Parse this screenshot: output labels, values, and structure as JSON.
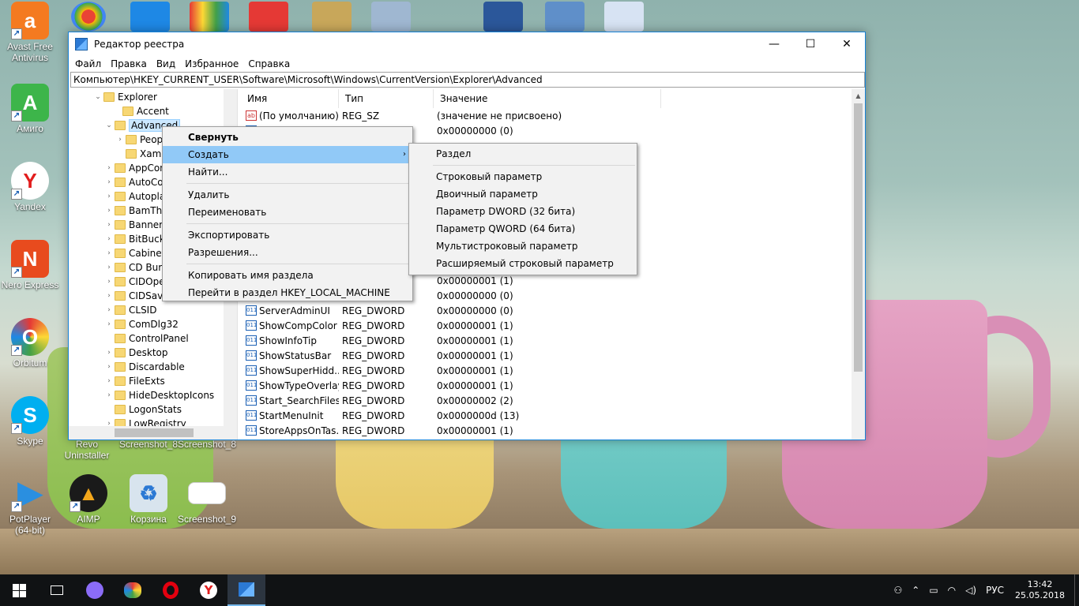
{
  "desktop": {
    "icons": [
      {
        "label": "Avast Free Antivirus",
        "color": "#f47a20",
        "glyph": "a"
      },
      {
        "label": "Амиго",
        "color": "#3db54a",
        "glyph": "A"
      },
      {
        "label": "Yandex",
        "color": "#ffffff",
        "glyph": "Y"
      },
      {
        "label": "Nero Express",
        "color": "#e84b1e",
        "glyph": "N"
      },
      {
        "label": "Orbitum",
        "color": "#e9a52c",
        "glyph": "O"
      },
      {
        "label": "Skype",
        "color": "#00aff0",
        "glyph": "S"
      },
      {
        "label": "PotPlayer (64-bit)",
        "color": "#2a8fe0",
        "glyph": "▶"
      },
      {
        "label": "AIMP",
        "color": "#f3a71b",
        "glyph": "▲"
      },
      {
        "label": "Корзина",
        "color": "#d8e4ee",
        "glyph": "♻"
      },
      {
        "label": "Screenshot_9",
        "color": "#ffffff",
        "glyph": ""
      },
      {
        "label": "Revo Uninstaller",
        "color": "",
        "glyph": ""
      },
      {
        "label": "Screenshot_8",
        "color": "",
        "glyph": ""
      },
      {
        "label": "Screenshot_8",
        "color": "",
        "glyph": ""
      }
    ]
  },
  "window": {
    "title": "Редактор реестра",
    "controls": {
      "minimize": "—",
      "maximize": "☐",
      "close": "✕"
    },
    "menu": [
      "Файл",
      "Правка",
      "Вид",
      "Избранное",
      "Справка"
    ],
    "address": "Компьютер\\HKEY_CURRENT_USER\\Software\\Microsoft\\Windows\\CurrentVersion\\Explorer\\Advanced"
  },
  "tree": {
    "items": [
      {
        "label": "Explorer",
        "expander": "⌄"
      },
      {
        "label": "Accent",
        "expander": ""
      },
      {
        "label": "Advanced",
        "expander": "⌄"
      },
      {
        "label": "Peop",
        "expander": "›"
      },
      {
        "label": "Xaml",
        "expander": ""
      },
      {
        "label": "AppCon",
        "expander": "›"
      },
      {
        "label": "AutoCor",
        "expander": "›"
      },
      {
        "label": "Autoplay",
        "expander": "›"
      },
      {
        "label": "BamThr",
        "expander": "›"
      },
      {
        "label": "BannerS",
        "expander": "›"
      },
      {
        "label": "BitBucke",
        "expander": "›"
      },
      {
        "label": "CabinetS",
        "expander": "›"
      },
      {
        "label": "CD Burn",
        "expander": "›"
      },
      {
        "label": "CIDOpen",
        "expander": "›"
      },
      {
        "label": "CIDSave",
        "expander": "›"
      },
      {
        "label": "CLSID",
        "expander": "›"
      },
      {
        "label": "ComDlg32",
        "expander": "›"
      },
      {
        "label": "ControlPanel",
        "expander": ""
      },
      {
        "label": "Desktop",
        "expander": "›"
      },
      {
        "label": "Discardable",
        "expander": "›"
      },
      {
        "label": "FileExts",
        "expander": "›"
      },
      {
        "label": "HideDesktopIcons",
        "expander": "›"
      },
      {
        "label": "LogonStats",
        "expander": ""
      },
      {
        "label": "LowRegistry",
        "expander": "›"
      }
    ]
  },
  "list": {
    "headers": [
      "Имя",
      "Тип",
      "Значение"
    ],
    "rows": [
      {
        "name": "(По умолчанию)",
        "type": "REG_SZ",
        "value": "(значение не присвоено)",
        "icon": "ab"
      },
      {
        "name": "",
        "type": "",
        "value": "0x00000000 (0)",
        "icon": "dw"
      },
      {
        "name": "",
        "type": "",
        "value": "",
        "icon": ""
      },
      {
        "name": "",
        "type": "",
        "value": "",
        "icon": ""
      },
      {
        "name": "",
        "type": "",
        "value": "",
        "icon": ""
      },
      {
        "name": "",
        "type": "",
        "value": "",
        "icon": ""
      },
      {
        "name": "",
        "type": "",
        "value": "",
        "icon": ""
      },
      {
        "name": "",
        "type": "",
        "value": "",
        "icon": ""
      },
      {
        "name": "",
        "type": "",
        "value": "",
        "icon": ""
      },
      {
        "name": "",
        "type": "",
        "value": "",
        "icon": ""
      },
      {
        "name": "",
        "type": "",
        "value": "",
        "icon": ""
      },
      {
        "name": "",
        "type": "",
        "value": "0x00000001 (1)",
        "icon": ""
      },
      {
        "name": "",
        "type": "",
        "value": "0x00000000 (0)",
        "icon": ""
      },
      {
        "name": "ServerAdminUI",
        "type": "REG_DWORD",
        "value": "0x00000000 (0)",
        "icon": "dw"
      },
      {
        "name": "ShowCompColor",
        "type": "REG_DWORD",
        "value": "0x00000001 (1)",
        "icon": "dw"
      },
      {
        "name": "ShowInfoTip",
        "type": "REG_DWORD",
        "value": "0x00000001 (1)",
        "icon": "dw"
      },
      {
        "name": "ShowStatusBar",
        "type": "REG_DWORD",
        "value": "0x00000001 (1)",
        "icon": "dw"
      },
      {
        "name": "ShowSuperHidd...",
        "type": "REG_DWORD",
        "value": "0x00000001 (1)",
        "icon": "dw"
      },
      {
        "name": "ShowTypeOverlay",
        "type": "REG_DWORD",
        "value": "0x00000001 (1)",
        "icon": "dw"
      },
      {
        "name": "Start_SearchFiles",
        "type": "REG_DWORD",
        "value": "0x00000002 (2)",
        "icon": "dw"
      },
      {
        "name": "StartMenuInit",
        "type": "REG_DWORD",
        "value": "0x0000000d (13)",
        "icon": "dw"
      },
      {
        "name": "StoreAppsOnTas...",
        "type": "REG_DWORD",
        "value": "0x00000001 (1)",
        "icon": "dw"
      }
    ]
  },
  "context_menu": {
    "collapse": "Свернуть",
    "create": "Создать",
    "find": "Найти...",
    "delete": "Удалить",
    "rename": "Переименовать",
    "export": "Экспортировать",
    "permissions": "Разрешения...",
    "copy_key_name": "Копировать имя раздела",
    "goto_hklm": "Перейти в раздел HKEY_LOCAL_MACHINE",
    "submenu_arrow": "›"
  },
  "submenu": {
    "key": "Раздел",
    "string": "Строковый параметр",
    "binary": "Двоичный параметр",
    "dword": "Параметр DWORD (32 бита)",
    "qword": "Параметр QWORD (64 бита)",
    "multistring": "Мультистроковый параметр",
    "expandstring": "Расширяемый строковый параметр"
  },
  "taskbar": {
    "language": "РУС",
    "time": "13:42",
    "date": "25.05.2018"
  }
}
